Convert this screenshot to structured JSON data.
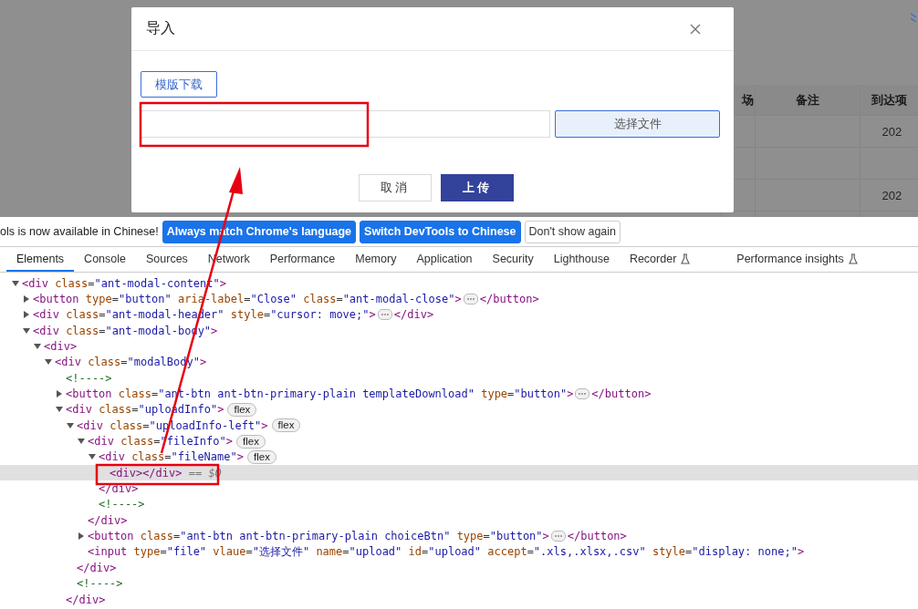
{
  "page": {
    "table": {
      "columns": [
        {
          "label": "场"
        },
        {
          "label": "备注"
        },
        {
          "label": "到达项"
        }
      ],
      "rows": [
        [
          "",
          "",
          "202"
        ],
        [
          "",
          "",
          ""
        ],
        [
          "",
          "",
          "202"
        ],
        [
          "",
          "",
          ""
        ]
      ]
    }
  },
  "modal": {
    "title": "导入",
    "template_button": "模版下载",
    "choose_button": "选择文件",
    "cancel_button": "取消",
    "upload_button": "上传"
  },
  "devtools": {
    "infobar": {
      "message": "ols is now available in Chinese!",
      "buttons": [
        {
          "label": "Always match Chrome's language",
          "kind": "primary"
        },
        {
          "label": "Switch DevTools to Chinese",
          "kind": "primary"
        },
        {
          "label": "Don't show again",
          "kind": "plain"
        }
      ]
    },
    "tabs": [
      {
        "label": "Elements",
        "selected": true,
        "experimental": false
      },
      {
        "label": "Console",
        "selected": false,
        "experimental": false
      },
      {
        "label": "Sources",
        "selected": false,
        "experimental": false
      },
      {
        "label": "Network",
        "selected": false,
        "experimental": false
      },
      {
        "label": "Performance",
        "selected": false,
        "experimental": false
      },
      {
        "label": "Memory",
        "selected": false,
        "experimental": false
      },
      {
        "label": "Application",
        "selected": false,
        "experimental": false
      },
      {
        "label": "Security",
        "selected": false,
        "experimental": false
      },
      {
        "label": "Lighthouse",
        "selected": false,
        "experimental": false
      },
      {
        "label": "Recorder",
        "selected": false,
        "experimental": true
      },
      {
        "label": "Performance insights",
        "selected": false,
        "experimental": true
      }
    ],
    "tree": [
      {
        "open": "<div class=\"ant-modal-content\">",
        "expanded": true,
        "selected": false,
        "children": [
          {
            "open": "<button type=\"button\" aria-label=\"Close\" class=\"ant-modal-close\">",
            "expanded": false,
            "end": "</button>",
            "selected": false
          },
          {
            "open": "<div class=\"ant-modal-header\" style=\"cursor: move;\">",
            "expanded": false,
            "end": "</div>",
            "selected": false
          },
          {
            "open": "<div class=\"ant-modal-body\">",
            "expanded": true,
            "selected": false,
            "children": [
              {
                "open": "<div>",
                "expanded": true,
                "selected": false,
                "children": [
                  {
                    "open": "<div class=\"modalBody\">",
                    "expanded": true,
                    "selected": false,
                    "children": [
                      {
                        "open": "<!---->",
                        "selected": false
                      },
                      {
                        "open": "<button class=\"ant-btn ant-btn-primary-plain templateDownload\" type=\"button\">",
                        "expanded": false,
                        "end": "</button>",
                        "selected": false
                      },
                      {
                        "open": "<div class=\"uploadInfo\">",
                        "expanded": true,
                        "badge": "flex",
                        "selected": false,
                        "close": "</div>",
                        "children": [
                          {
                            "open": "<div class=\"uploadInfo-left\">",
                            "expanded": true,
                            "badge": "flex",
                            "selected": false,
                            "close": "</div>",
                            "children": [
                              {
                                "open": "<div class=\"fileInfo\">",
                                "expanded": true,
                                "badge": "flex",
                                "selected": false,
                                "close": "</div>",
                                "children": [
                                  {
                                    "open": "<div class=\"fileName\">",
                                    "expanded": true,
                                    "badge": "flex",
                                    "selected": false,
                                    "close": "</div>",
                                    "children": [
                                      {
                                        "open": "<div></div>",
                                        "suffix": "== $0",
                                        "selected": true
                                      }
                                    ]
                                  },
                                  {
                                    "open": "<!---->",
                                    "selected": false
                                  }
                                ]
                              },
                              {
                                "open": "<button class=\"ant-btn ant-btn-primary-plain choiceBtn\" type=\"button\">",
                                "expanded": false,
                                "end": "</button>",
                                "selected": false
                              },
                              {
                                "open": "<input type=\"file\" vlaue=\"选择文件\" name=\"upload\" id=\"upload\" accept=\".xls,.xlsx,.csv\" style=\"display: none;\">",
                                "selected": false
                              }
                            ]
                          },
                          {
                            "open": "<!---->",
                            "selected": false
                          }
                        ]
                      }
                    ]
                  }
                ]
              }
            ]
          }
        ]
      }
    ]
  }
}
